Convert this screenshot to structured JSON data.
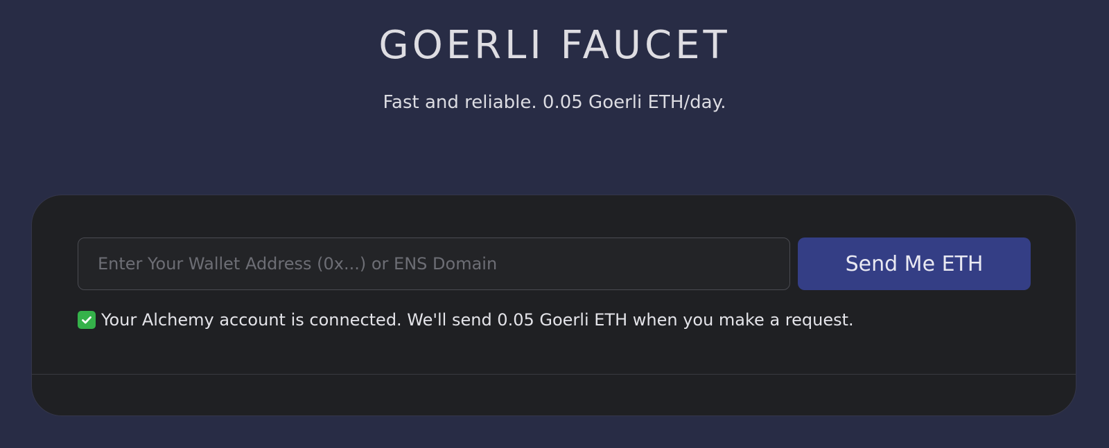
{
  "header": {
    "title": "GOERLI FAUCET",
    "subtitle": "Fast and reliable. 0.05 Goerli ETH/day."
  },
  "form": {
    "wallet_placeholder": "Enter Your Wallet Address (0x...) or ENS Domain",
    "wallet_value": "",
    "send_button_label": "Send Me ETH"
  },
  "status": {
    "icon": "check-icon",
    "message": "Your Alchemy account is connected. We'll send 0.05 Goerli ETH when you make a request."
  },
  "colors": {
    "background": "#282c45",
    "card": "#1f2023",
    "button": "#343e85",
    "check": "#35b24a"
  }
}
